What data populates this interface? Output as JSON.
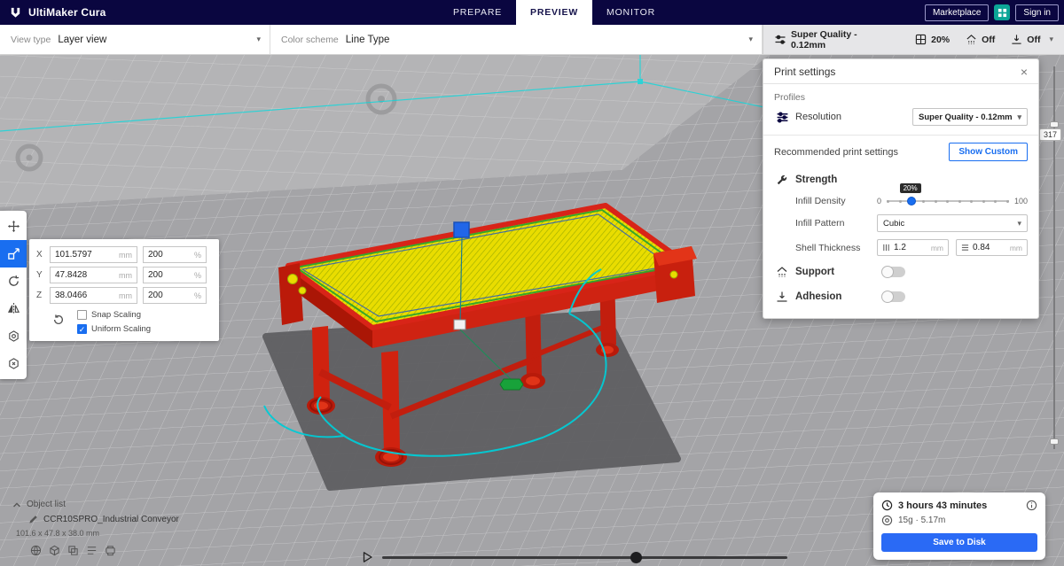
{
  "colors": {
    "accent_blue": "#196ef0",
    "header_navy": "#0a0640",
    "marketplace_teal": "#0ca597",
    "save_button_blue": "#2a6af5",
    "model_red": "#d82418",
    "infill_yellow": "#e9dd00",
    "travel_cyan": "#00ccd6"
  },
  "header": {
    "app_name": "UltiMaker Cura",
    "tabs": [
      {
        "label": "PREPARE"
      },
      {
        "label": "PREVIEW"
      },
      {
        "label": "MONITOR"
      }
    ],
    "active_tab": "PREVIEW",
    "marketplace_label": "Marketplace",
    "sign_in_label": "Sign in"
  },
  "view_toolbar": {
    "view_type_label": "View type",
    "view_type_value": "Layer view",
    "color_scheme_label": "Color scheme",
    "color_scheme_value": "Line Type",
    "summary": {
      "quality": "Super Quality - 0.12mm",
      "infill": "20%",
      "support": "Off",
      "adhesion": "Off"
    }
  },
  "print_settings": {
    "title": "Print settings",
    "profiles_label": "Profiles",
    "resolution_label": "Resolution",
    "resolution_value": "Super Quality - 0.12mm",
    "recommended_label": "Recommended print settings",
    "show_custom_label": "Show Custom",
    "strength": {
      "label": "Strength",
      "infill_density_label": "Infill Density",
      "infill_density_value": "20%",
      "infill_density_percent": 20,
      "slider_min": "0",
      "slider_max": "100",
      "infill_pattern_label": "Infill Pattern",
      "infill_pattern_value": "Cubic",
      "shell_thickness_label": "Shell Thickness",
      "wall_thickness": "1.2",
      "top_bottom_thickness": "0.84",
      "unit_mm": "mm"
    },
    "support_label": "Support",
    "support_enabled": false,
    "adhesion_label": "Adhesion",
    "adhesion_enabled": false
  },
  "tool_icons": [
    "move",
    "scale",
    "rotate",
    "mirror",
    "per-model-settings",
    "support-blocker"
  ],
  "active_tool": "scale",
  "scale_panel": {
    "rows": [
      {
        "axis": "X",
        "size": "101.5797",
        "unit": "mm",
        "percent": "200",
        "percent_unit": "%"
      },
      {
        "axis": "Y",
        "size": "47.8428",
        "unit": "mm",
        "percent": "200",
        "percent_unit": "%"
      },
      {
        "axis": "Z",
        "size": "38.0466",
        "unit": "mm",
        "percent": "200",
        "percent_unit": "%"
      }
    ],
    "snap_scaling_label": "Snap Scaling",
    "snap_scaling_checked": false,
    "uniform_scaling_label": "Uniform Scaling",
    "uniform_scaling_checked": true
  },
  "layer_slider": {
    "current_layer": "317"
  },
  "object_list": {
    "title": "Object list",
    "object_name": "CCR10SPRO_Industrial Conveyor",
    "object_dims": "101.6 x 47.8 x 38.0 mm"
  },
  "job_info": {
    "print_time": "3 hours 43 minutes",
    "material_usage": "15g · 5.17m",
    "save_button_label": "Save to Disk"
  }
}
